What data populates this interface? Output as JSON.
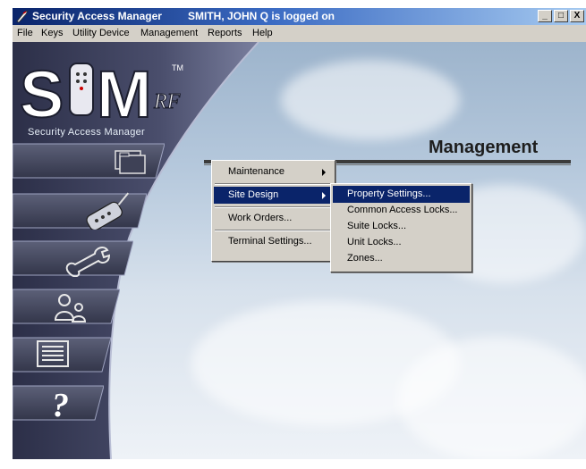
{
  "window": {
    "title": "Security Access Manager",
    "status": "SMITH, JOHN Q is logged on",
    "controls": {
      "minimize": "_",
      "maximize": "□",
      "close": "X"
    }
  },
  "menubar": [
    "File",
    "Keys",
    "Utility Device",
    "Management",
    "Reports",
    "Help"
  ],
  "logo": {
    "text": "S M",
    "superscript": "TM",
    "suffix": "RF",
    "tagline": "Security Access Manager"
  },
  "sidebar": {
    "buttons": [
      {
        "icon": "folders-icon"
      },
      {
        "icon": "key-fob-icon"
      },
      {
        "icon": "wrench-icon"
      },
      {
        "icon": "users-icon"
      },
      {
        "icon": "list-icon"
      },
      {
        "icon": "help-icon",
        "label": "?"
      }
    ]
  },
  "main": {
    "title": "Management"
  },
  "management_menu": {
    "items": [
      {
        "label": "Maintenance",
        "submenu": true,
        "selected": false
      },
      {
        "label": "Site Design",
        "submenu": true,
        "selected": true
      },
      {
        "label": "Work Orders...",
        "submenu": false,
        "selected": false
      },
      {
        "label": "Terminal Settings...",
        "submenu": false,
        "selected": false
      }
    ]
  },
  "site_design_menu": {
    "items": [
      {
        "label": "Property Settings...",
        "selected": true
      },
      {
        "label": "Common Access Locks...",
        "selected": false
      },
      {
        "label": "Suite Locks...",
        "selected": false
      },
      {
        "label": "Unit Locks...",
        "selected": false
      },
      {
        "label": "Zones...",
        "selected": false
      }
    ]
  },
  "colors": {
    "titlebar_start": "#0a246a",
    "titlebar_end": "#a6caf0",
    "menu_face": "#d4d0c8",
    "highlight": "#0a246a",
    "sidebar": "#4a4e6c"
  }
}
